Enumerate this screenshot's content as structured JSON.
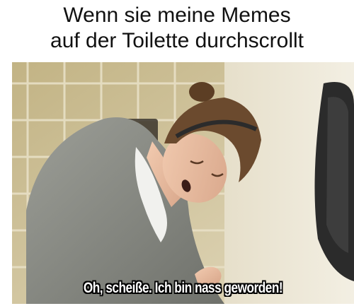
{
  "meme": {
    "caption_line1": "Wenn sie meine Memes",
    "caption_line2": "auf der Toilette durchscrollt",
    "subtitle": "Oh, scheiße. Ich bin nass geworden!"
  },
  "colors": {
    "tile_wall": "#c9b98a",
    "sweater": "#8f918b",
    "hair": "#6b4a2e",
    "dispenser": "#2a2a2a"
  }
}
